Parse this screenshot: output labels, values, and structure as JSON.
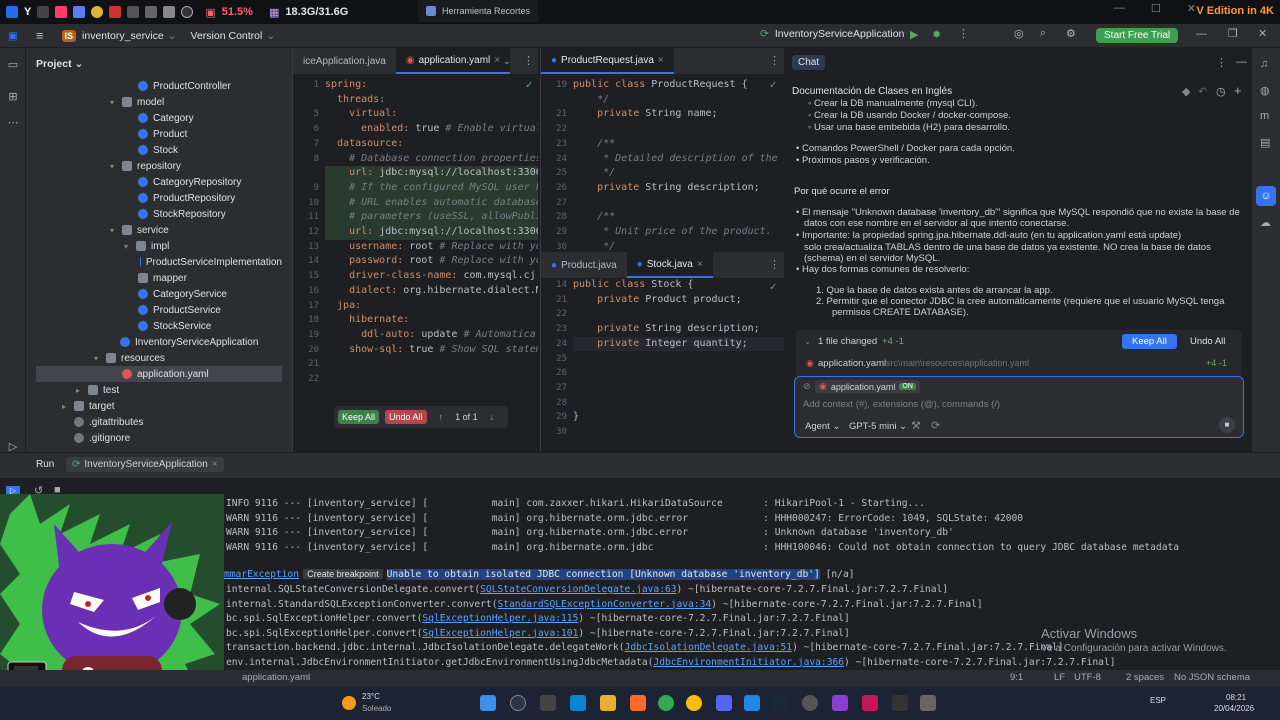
{
  "sysbar": {
    "cpu": "51.5%",
    "mem": "18.3G/31.6G"
  },
  "snip": {
    "title": "Herramienta Recortes"
  },
  "edition": "V Edition in 4K",
  "header": {
    "badge": "IS",
    "project": "inventory_service",
    "vcs": "Version Control",
    "run_config": "InventoryServiceApplication",
    "trial": "Start Free Trial"
  },
  "project_panel": {
    "title": "Project",
    "nodes": [
      {
        "label": "ProductController",
        "kind": "cls"
      },
      {
        "label": "model",
        "kind": "fold"
      },
      {
        "label": "Category",
        "kind": "cls"
      },
      {
        "label": "Product",
        "kind": "cls"
      },
      {
        "label": "Stock",
        "kind": "cls"
      },
      {
        "label": "repository",
        "kind": "fold"
      },
      {
        "label": "CategoryRepository",
        "kind": "cls"
      },
      {
        "label": "ProductRepository",
        "kind": "cls"
      },
      {
        "label": "StockRepository",
        "kind": "cls"
      },
      {
        "label": "service",
        "kind": "fold"
      },
      {
        "label": "impl",
        "kind": "fold"
      },
      {
        "label": "ProductServiceImplementation",
        "kind": "cls"
      },
      {
        "label": "mapper",
        "kind": "fold"
      },
      {
        "label": "CategoryService",
        "kind": "cls"
      },
      {
        "label": "ProductService",
        "kind": "cls"
      },
      {
        "label": "StockService",
        "kind": "cls"
      },
      {
        "label": "InventoryServiceApplication",
        "kind": "cls"
      },
      {
        "label": "resources",
        "kind": "fold"
      },
      {
        "label": "application.yaml",
        "kind": "yml"
      },
      {
        "label": "test",
        "kind": "fold"
      },
      {
        "label": "target",
        "kind": "fold"
      },
      {
        "label": ".gitattributes",
        "kind": "git"
      },
      {
        "label": ".gitignore",
        "kind": "git"
      }
    ]
  },
  "editor1": {
    "tabs": [
      "iceApplication.java",
      "application.yaml"
    ],
    "lines": [
      {
        "n": "1",
        "t": "spring:"
      },
      {
        "n": "",
        "t": "  threads:"
      },
      {
        "n": "5",
        "t": "    virtual:"
      },
      {
        "n": "6",
        "t": "      enabled: true # Enable virtual t"
      },
      {
        "n": "7",
        "t": "  datasource:"
      },
      {
        "n": "8",
        "t": "    # Database connection properties"
      },
      {
        "n": "",
        "t": "    url: jdbc:mysql://localhost:3306/i"
      },
      {
        "n": "9",
        "t": "    # If the configured MySQL user has"
      },
      {
        "n": "10",
        "t": "    # URL enables automatic database c"
      },
      {
        "n": "11",
        "t": "    # parameters (useSSL, allowPublic"
      },
      {
        "n": "12",
        "t": "    url: jdbc:mysql://localhost:3306/i"
      },
      {
        "n": "13",
        "t": "    username: root # Replace with you"
      },
      {
        "n": "14",
        "t": "    password: root # Replace with you"
      },
      {
        "n": "15",
        "t": "    driver-class-name: com.mysql.cj.j"
      },
      {
        "n": "16",
        "t": "    dialect: org.hibernate.dialect.MyS"
      },
      {
        "n": "17",
        "t": "  jpa:"
      },
      {
        "n": "18",
        "t": "    hibernate:"
      },
      {
        "n": "19",
        "t": "      ddl-auto: update # Automatica"
      },
      {
        "n": "20",
        "t": "    show-sql: true # Show SQL statemen"
      },
      {
        "n": "21",
        "t": ""
      },
      {
        "n": "22",
        "t": ""
      }
    ],
    "diffbar": {
      "keep": "Keep All",
      "undo": "Undo All",
      "count": "1 of 1"
    }
  },
  "editor2": {
    "tab": "ProductRequest.java",
    "lines": [
      {
        "n": "19",
        "t": "public class ProductRequest {"
      },
      {
        "n": "",
        "t": "    */"
      },
      {
        "n": "21",
        "t": "    private String name;"
      },
      {
        "n": "22",
        "t": ""
      },
      {
        "n": "23",
        "t": "    /**"
      },
      {
        "n": "24",
        "t": "     * Detailed description of the pr"
      },
      {
        "n": "25",
        "t": "     */"
      },
      {
        "n": "26",
        "t": "    private String description;"
      },
      {
        "n": "27",
        "t": ""
      },
      {
        "n": "28",
        "t": "    /**"
      },
      {
        "n": "29",
        "t": "     * Unit price of the product."
      },
      {
        "n": "30",
        "t": "     */"
      }
    ]
  },
  "editor3": {
    "tabs": [
      "Product.java",
      "Stock.java"
    ],
    "lines": [
      {
        "n": "14",
        "t": "public class Stock {"
      },
      {
        "n": "21",
        "t": "    private Product product;"
      },
      {
        "n": "22",
        "t": ""
      },
      {
        "n": "23",
        "t": "    private String description;"
      },
      {
        "n": "24",
        "t": "    private Integer quantity;"
      },
      {
        "n": "25",
        "t": ""
      },
      {
        "n": "26",
        "t": ""
      },
      {
        "n": "27",
        "t": ""
      },
      {
        "n": "28",
        "t": ""
      },
      {
        "n": "29",
        "t": "}"
      },
      {
        "n": "30",
        "t": ""
      }
    ]
  },
  "chat": {
    "tab": "Chat",
    "heading": "Documentación de Clases en Inglés",
    "lines": [
      "◦ Crear la DB manualmente (mysql CLI).",
      "◦ Crear la DB usando Docker / docker-compose.",
      "◦ Usar una base embebida (H2) para desarrollo.",
      "• Comandos PowerShell / Docker para cada opción.",
      "• Próximos pasos y verificación.",
      "Por qué ocurre el error",
      "• El mensaje \"Unknown database 'inventory_db'\" significa que MySQL respondió que no existe la base de",
      "  datos con ese nombre en el servidor al que intentó conectarse.",
      "• Importante: la propiedad spring.jpa.hibernate.ddl-auto (en tu application.yaml está update)",
      "  solo crea/actualiza TABLAS dentro de una base de datos ya existente. NO crea la base de datos",
      "  (schema) en el servidor MySQL.",
      "• Hay dos formas comunes de resolverlo:",
      "1. Que la base de datos exista antes de arrancar la app.",
      "2. Permitir que el conector JDBC la cree automáticamente (requiere que el usuario MySQL tenga",
      "   permisos CREATE DATABASE)."
    ],
    "changed": {
      "label": "1 file changed",
      "delta": "+4 -1",
      "keep": "Keep All",
      "undo": "Undo All",
      "file": "application.yaml",
      "path": "src\\main\\resources\\application.yaml",
      "file_delta": "+4 -1"
    },
    "input": {
      "chip": "application.yaml",
      "chip_tag": "ON",
      "placeholder": "Add context (#), extensions (@), commands (/)",
      "mode": "Agent",
      "model": "GPT-5 mini"
    }
  },
  "run": {
    "tab": "Run",
    "config": "InventoryServiceApplication",
    "lines": [
      "INFO 9116 --- [inventory_service] [           main] com.zaxxer.hikari.HikariDataSource       : HikariPool-1 - Starting...",
      "WARN 9116 --- [inventory_service] [           main] org.hibernate.orm.jdbc.error             : HHH000247: ErrorCode: 1049, SQLState: 42000",
      "WARN 9116 --- [inventory_service] [           main] org.hibernate.orm.jdbc.error             : Unknown database 'inventory_db'",
      "WARN 9116 --- [inventory_service] [           main] org.hibernate.orm.jdbc                   : HHH100046: Could not obtain connection to query JDBC database metadata"
    ],
    "exception": "mmarException",
    "breakpoint": "Create breakpoint",
    "err_msg": "Unable to obtain isolated JDBC connection [Unknown database 'inventory_db']",
    "err_tail": " [n/a]",
    "trace": [
      {
        "pre": "internal.SQLStateConversionDelegate.convert(",
        "link": "SQLStateConversionDelegate.java:63",
        "post": ") ~[hibernate-core-7.2.7.Final.jar:7.2.7.Final]"
      },
      {
        "pre": "internal.StandardSQLExceptionConverter.convert(",
        "link": "StandardSQLExceptionConverter.java:34",
        "post": ") ~[hibernate-core-7.2.7.Final.jar:7.2.7.Final]"
      },
      {
        "pre": "bc.spi.SqlExceptionHelper.convert(",
        "link": "SqlExceptionHelper.java:115",
        "post": ") ~[hibernate-core-7.2.7.Final.jar:7.2.7.Final]"
      },
      {
        "pre": "bc.spi.SqlExceptionHelper.convert(",
        "link": "SqlExceptionHelper.java:101",
        "post": ") ~[hibernate-core-7.2.7.Final.jar:7.2.7.Final]"
      },
      {
        "pre": "transaction.backend.jdbc.internal.JdbcIsolationDelegate.delegateWork(",
        "link": "JdbcIsolationDelegate.java:51",
        "post": ") ~[hibernate-core-7.2.7.Final.jar:7.2.7.Final]"
      },
      {
        "pre": "env.internal.JdbcEnvironmentInitiator.getJdbcEnvironmentUsingJdbcMetadata(",
        "link": "JdbcEnvironmentInitiator.java:366",
        "post": ") ~[hibernate-core-7.2.7.Final.jar:7.2.7.Final]"
      }
    ]
  },
  "activate": {
    "title": "Activar Windows",
    "sub": "Ve a Configuración para activar Windows."
  },
  "status": {
    "file": "application.yaml",
    "pos": "9:1",
    "eol": "LF",
    "enc": "UTF-8",
    "indent": "2 spaces",
    "schema": "No JSON schema"
  },
  "taskbar": {
    "temp": "23°C",
    "weather": "Soleado",
    "lang": "ESP",
    "time": "08:21",
    "date": "20/04/2026"
  }
}
